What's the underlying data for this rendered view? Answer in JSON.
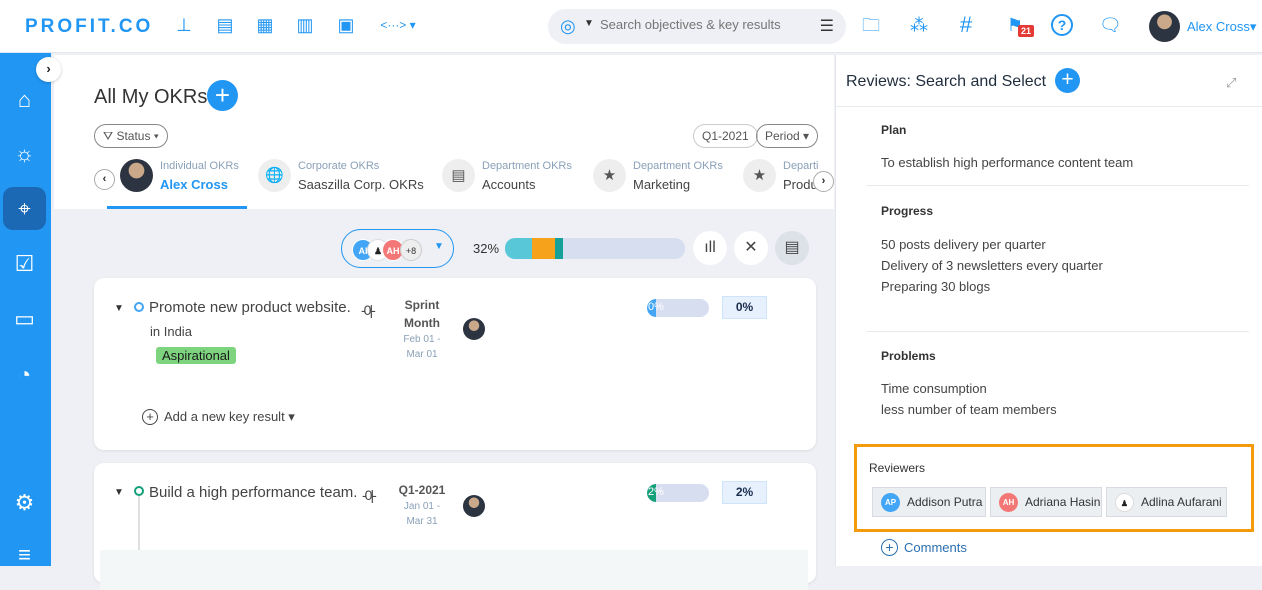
{
  "topbar": {
    "logo": "PROFIT.CO",
    "nav_icons": [
      "align-icon",
      "document-icon",
      "grid-icon",
      "table-icon",
      "report-icon",
      "more-icon"
    ],
    "more_caret": "▾",
    "search": {
      "placeholder": "Search objectives & key results",
      "value": ""
    },
    "right_icons": [
      "folder-search-icon",
      "hierarchy-icon",
      "hashtag-icon",
      "flag-icon",
      "help-icon",
      "chat-icon"
    ],
    "notification_count": "21",
    "user_name": "Alex Cross"
  },
  "sidebar": {
    "items": [
      {
        "name": "home",
        "glyph": "⌂"
      },
      {
        "name": "ideas",
        "glyph": "💡"
      },
      {
        "name": "okrs",
        "glyph": "⊕",
        "active": true
      },
      {
        "name": "tasks",
        "glyph": "☑"
      },
      {
        "name": "feedback",
        "glyph": "▭"
      },
      {
        "name": "dashboard",
        "glyph": "◔"
      },
      {
        "name": "settings",
        "glyph": "⚙"
      },
      {
        "name": "filters",
        "glyph": "≡"
      }
    ]
  },
  "main": {
    "title": "All My OKRs",
    "filters": {
      "status_label": "Status",
      "period_value": "Q1-2021",
      "period_label": "Period"
    },
    "tabs": [
      {
        "sub": "Individual OKRs",
        "main": "Alex Cross",
        "active": true
      },
      {
        "sub": "Corporate OKRs",
        "main": "Saaszilla Corp. OKRs"
      },
      {
        "sub": "Department OKRs",
        "main": "Accounts"
      },
      {
        "sub": "Department OKRs",
        "main": "Marketing"
      },
      {
        "sub": "Departi",
        "main": "Produ"
      }
    ],
    "toolbar": {
      "avatars": [
        {
          "initials": "AI",
          "color": "#42a5f5"
        },
        {
          "initials": "",
          "color": "#ffffff"
        },
        {
          "initials": "AH",
          "color": "#f47777"
        }
      ],
      "more_count": "+8",
      "overall_progress_label": "32%",
      "overall_progress": 32,
      "progress_segments": [
        {
          "percent": 15,
          "color": "#58c7d8"
        },
        {
          "percent": 13,
          "color": "#f7a21b"
        },
        {
          "percent": 4,
          "color": "#15a09a"
        }
      ]
    },
    "objectives": [
      {
        "title": "Promote new product website.",
        "subtitle": "in India",
        "tag": "Aspirational",
        "period_name": "Sprint Month",
        "period_name_1": "Sprint",
        "period_name_2": "Month",
        "date_1": "Feb 01 -",
        "date_2": "Mar 01",
        "progress": 0,
        "progress_label": "0%",
        "progress_color": "#42a5f5",
        "dot_color": "#42a5f5",
        "add_key_result": "Add a new key result"
      },
      {
        "title": "Build a high performance team.",
        "period_name": "Q1-2021",
        "date_1": "Jan 01 -",
        "date_2": "Mar 31",
        "progress": 2,
        "progress_label": "2%",
        "progress_color": "#15a07a",
        "dot_color": "#15a07a"
      }
    ]
  },
  "review_panel": {
    "title": "Reviews: Search and Select",
    "sections": {
      "plan": {
        "label": "Plan",
        "lines": [
          "To establish high performance content team"
        ]
      },
      "progress": {
        "label": "Progress",
        "lines": [
          "50 posts delivery per quarter",
          "Delivery of 3 newsletters every quarter",
          "Preparing 30 blogs"
        ]
      },
      "problems": {
        "label": "Problems",
        "lines": [
          "Time consumption",
          "less number of team members"
        ]
      }
    },
    "reviewers_label": "Reviewers",
    "reviewers": [
      {
        "initials": "AP",
        "name": "Addison Putra",
        "color": "#42a5f5"
      },
      {
        "initials": "AH",
        "name": "Adriana Hasin",
        "color": "#f47777"
      },
      {
        "initials": "",
        "name": "Adlina Aufarani",
        "color": "#ffffff"
      }
    ],
    "comments_label": "Comments",
    "highlight_color": "#f59b0b"
  }
}
